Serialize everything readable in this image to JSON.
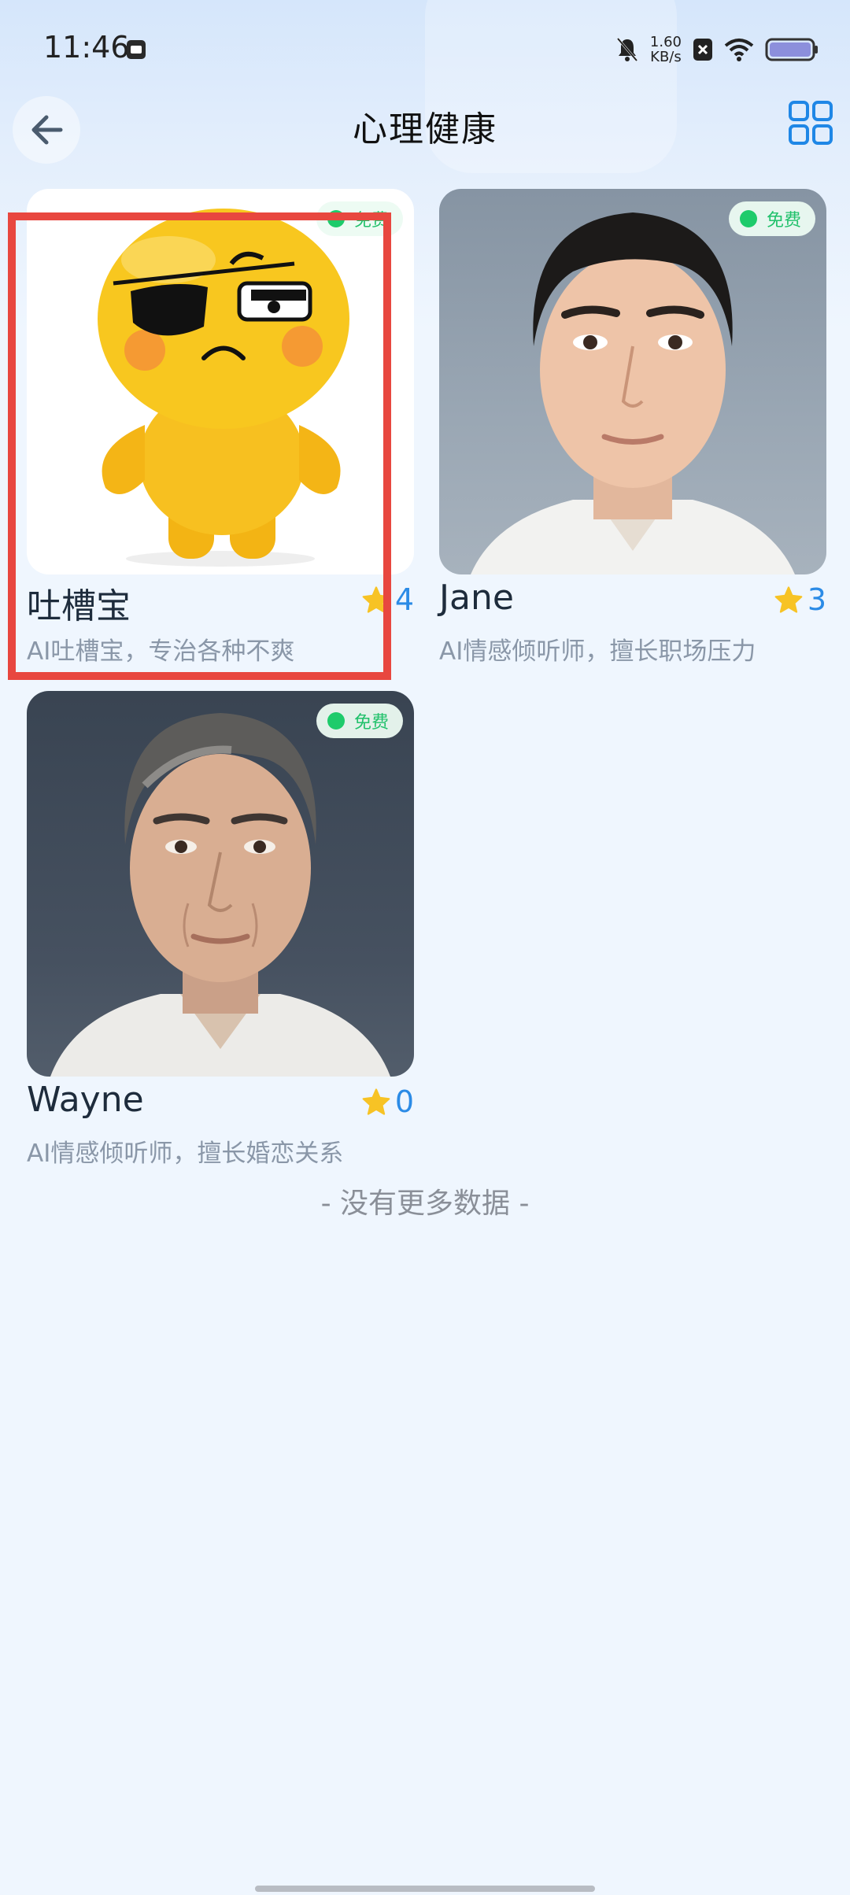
{
  "status_bar": {
    "time": "11:46",
    "net_speed_value": "1.60",
    "net_speed_unit": "KB/s"
  },
  "header": {
    "title": "心理健康"
  },
  "cards": [
    {
      "name": "吐槽宝",
      "rating": "4",
      "description": "AI吐槽宝，专治各种不爽",
      "badge": "免费"
    },
    {
      "name": "Jane",
      "rating": "3",
      "description": "AI情感倾听师，擅长职场压力",
      "badge": "免费"
    },
    {
      "name": "Wayne",
      "rating": "0",
      "description": "AI情感倾听师，擅长婚恋关系",
      "badge": "免费"
    }
  ],
  "footer": {
    "no_more": "- 没有更多数据 -"
  },
  "colors": {
    "accent": "#2b8be6",
    "free_badge": "#21c16b",
    "star": "#f7c325",
    "highlight": "#e8473f"
  }
}
